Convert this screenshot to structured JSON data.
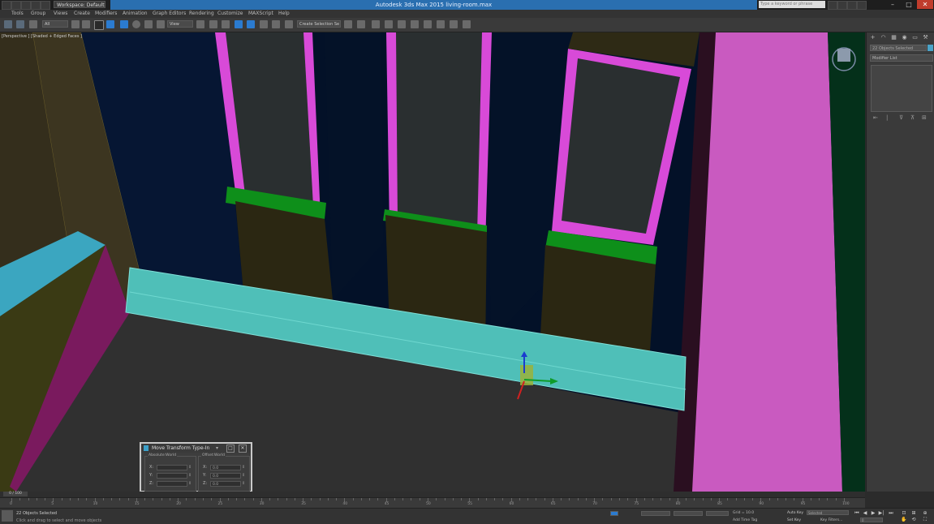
{
  "window": {
    "workspace": "Workspace: Default",
    "title": "Autodesk 3ds Max  2015     living-room.max",
    "search_placeholder": "Type a keyword or phrase",
    "minimize": "–",
    "maximize": "□",
    "close": "✕"
  },
  "menu": [
    "Tools",
    "Group",
    "Views",
    "Create",
    "Modifiers",
    "Animation",
    "Graph Editors",
    "Rendering",
    "Customize",
    "MAXScript",
    "Help"
  ],
  "toolbar": {
    "selection_filter": "All",
    "ref_coord": "View",
    "named_selection": "Create Selection Se"
  },
  "viewport": {
    "label": "[Perspective ] [Shaded + Edged Faces ]"
  },
  "command_panel": {
    "tabs": [
      "+",
      "◠",
      "▦",
      "◉",
      "▭",
      "⚒"
    ],
    "object_name": "22 Objects Selected",
    "modifier_list": "Modifier List",
    "stack_tools": [
      "⇤",
      "|",
      "⊽",
      "⊼",
      "⊞"
    ]
  },
  "dialog": {
    "title": "Move Transform Type-In",
    "pin": "▾",
    "restore": "□",
    "close": "✕",
    "absolute_label": "Absolute:World",
    "offset_label": "Offset:World",
    "absolute": [
      {
        "axis": "X:",
        "value": ""
      },
      {
        "axis": "Y:",
        "value": ""
      },
      {
        "axis": "Z:",
        "value": ""
      }
    ],
    "offset": [
      {
        "axis": "X:",
        "value": "0.0"
      },
      {
        "axis": "Y:",
        "value": "0.0"
      },
      {
        "axis": "Z:",
        "value": "0.0"
      }
    ],
    "spinner": "⇕"
  },
  "timeline": {
    "frame": "0 / 100",
    "ticks": [
      "0",
      "5",
      "10",
      "15",
      "20",
      "25",
      "30",
      "35",
      "40",
      "45",
      "50",
      "55",
      "60",
      "65",
      "70",
      "75",
      "80",
      "85",
      "90",
      "95",
      "100"
    ]
  },
  "status": {
    "selection": "22 Objects Selected",
    "prompt": "Click and drag to select and move objects",
    "grid": "Grid = 10.0",
    "autokey": "Auto Key",
    "setkey": "Set Key",
    "selected": "Selected",
    "key_filters": "Key Filters...",
    "add_time_tag": "Add Time Tag",
    "frame_field": "0"
  }
}
